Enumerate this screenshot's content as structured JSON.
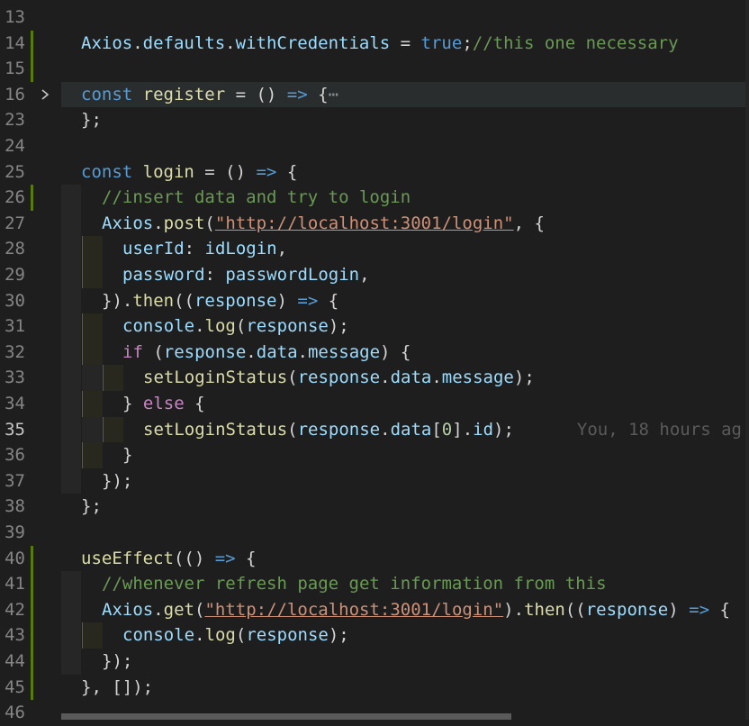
{
  "editor": {
    "theme": {
      "background": "#1e1e1e",
      "keyword": "#569cd6",
      "string": "#ce9178",
      "comment": "#6a9955",
      "function": "#dcdcaa",
      "variable": "#9cdcfe",
      "control": "#c586c0"
    },
    "blame_text": "You, 18 hours ag",
    "lines": [
      {
        "n": "13"
      },
      {
        "n": "14",
        "mark": "added",
        "tokens": [
          [
            "var",
            "Axios"
          ],
          [
            "p",
            "."
          ],
          [
            "var",
            "defaults"
          ],
          [
            "p",
            "."
          ],
          [
            "var",
            "withCredentials"
          ],
          [
            "p",
            " = "
          ],
          [
            "kw",
            "true"
          ],
          [
            "p",
            ";"
          ],
          [
            "cmt",
            "//this one necessary"
          ]
        ]
      },
      {
        "n": "15",
        "mark": "added"
      },
      {
        "n": "16",
        "fold": true,
        "tokens": [
          [
            "kw",
            "const "
          ],
          [
            "fn",
            "register"
          ],
          [
            "p",
            " = () "
          ],
          [
            "kw",
            "=>"
          ],
          [
            "p",
            " {"
          ],
          [
            "ell",
            "⋯"
          ]
        ]
      },
      {
        "n": "23",
        "tokens": [
          [
            "p",
            "};"
          ]
        ]
      },
      {
        "n": "24"
      },
      {
        "n": "25",
        "tokens": [
          [
            "kw",
            "const "
          ],
          [
            "fn",
            "login"
          ],
          [
            "p",
            " = () "
          ],
          [
            "kw",
            "=>"
          ],
          [
            "p",
            " {"
          ]
        ]
      },
      {
        "n": "26",
        "mark": "added",
        "indent": 1,
        "tokens": [
          [
            "cmt",
            "//insert data and try to login"
          ]
        ]
      },
      {
        "n": "27",
        "indent": 1,
        "tokens": [
          [
            "var",
            "Axios"
          ],
          [
            "p",
            "."
          ],
          [
            "fn",
            "post"
          ],
          [
            "p",
            "("
          ],
          [
            "url",
            "\"http://localhost:3001/login\""
          ],
          [
            "p",
            ", {"
          ]
        ]
      },
      {
        "n": "28",
        "indent": 2,
        "tokens": [
          [
            "var",
            "userId"
          ],
          [
            "p",
            ": "
          ],
          [
            "var",
            "idLogin"
          ],
          [
            "p",
            ","
          ]
        ]
      },
      {
        "n": "29",
        "indent": 2,
        "tokens": [
          [
            "var",
            "password"
          ],
          [
            "p",
            ": "
          ],
          [
            "var",
            "passwordLogin"
          ],
          [
            "p",
            ","
          ]
        ]
      },
      {
        "n": "30",
        "indent": 1,
        "tokens": [
          [
            "p",
            "})."
          ],
          [
            "fn",
            "then"
          ],
          [
            "p",
            "(("
          ],
          [
            "var",
            "response"
          ],
          [
            "p",
            ") "
          ],
          [
            "kw",
            "=>"
          ],
          [
            "p",
            " {"
          ]
        ]
      },
      {
        "n": "31",
        "indent": 2,
        "tokens": [
          [
            "var",
            "console"
          ],
          [
            "p",
            "."
          ],
          [
            "fn",
            "log"
          ],
          [
            "p",
            "("
          ],
          [
            "var",
            "response"
          ],
          [
            "p",
            ");"
          ]
        ]
      },
      {
        "n": "32",
        "indent": 2,
        "tokens": [
          [
            "ctrl",
            "if"
          ],
          [
            "p",
            " ("
          ],
          [
            "var",
            "response"
          ],
          [
            "p",
            "."
          ],
          [
            "var",
            "data"
          ],
          [
            "p",
            "."
          ],
          [
            "var",
            "message"
          ],
          [
            "p",
            ") {"
          ]
        ]
      },
      {
        "n": "33",
        "indent": 3,
        "tokens": [
          [
            "fn",
            "setLoginStatus"
          ],
          [
            "p",
            "("
          ],
          [
            "var",
            "response"
          ],
          [
            "p",
            "."
          ],
          [
            "var",
            "data"
          ],
          [
            "p",
            "."
          ],
          [
            "var",
            "message"
          ],
          [
            "p",
            ");"
          ]
        ]
      },
      {
        "n": "34",
        "indent": 2,
        "tokens": [
          [
            "p",
            "} "
          ],
          [
            "ctrl",
            "else"
          ],
          [
            "p",
            " {"
          ]
        ]
      },
      {
        "n": "35",
        "indent": 3,
        "current": true,
        "tokens": [
          [
            "fn",
            "setLoginStatus"
          ],
          [
            "p",
            "("
          ],
          [
            "var",
            "response"
          ],
          [
            "p",
            "."
          ],
          [
            "var",
            "data"
          ],
          [
            "p",
            "["
          ],
          [
            "num",
            "0"
          ],
          [
            "p",
            "]."
          ],
          [
            "var",
            "id"
          ],
          [
            "p",
            ");"
          ]
        ],
        "blame": true
      },
      {
        "n": "36",
        "indent": 2,
        "tokens": [
          [
            "p",
            "}"
          ]
        ]
      },
      {
        "n": "37",
        "indent": 1,
        "tokens": [
          [
            "p",
            "});"
          ]
        ]
      },
      {
        "n": "38",
        "tokens": [
          [
            "p",
            "};"
          ]
        ]
      },
      {
        "n": "39"
      },
      {
        "n": "40",
        "mark": "added",
        "tokens": [
          [
            "fn",
            "useEffect"
          ],
          [
            "p",
            "(() "
          ],
          [
            "kw",
            "=>"
          ],
          [
            "p",
            " {"
          ]
        ]
      },
      {
        "n": "41",
        "mark": "added",
        "indent": 1,
        "tokens": [
          [
            "cmt",
            "//whenever refresh page get information from this"
          ]
        ]
      },
      {
        "n": "42",
        "mark": "added",
        "indent": 1,
        "tokens": [
          [
            "var",
            "Axios"
          ],
          [
            "p",
            "."
          ],
          [
            "fn",
            "get"
          ],
          [
            "p",
            "("
          ],
          [
            "url",
            "\"http://localhost:3001/login\""
          ],
          [
            "p",
            ")."
          ],
          [
            "fn",
            "then"
          ],
          [
            "p",
            "(("
          ],
          [
            "var",
            "response"
          ],
          [
            "p",
            ") "
          ],
          [
            "kw",
            "=>"
          ],
          [
            "p",
            " {"
          ]
        ]
      },
      {
        "n": "43",
        "mark": "added",
        "indent": 2,
        "tokens": [
          [
            "var",
            "console"
          ],
          [
            "p",
            "."
          ],
          [
            "fn",
            "log"
          ],
          [
            "p",
            "("
          ],
          [
            "var",
            "response"
          ],
          [
            "p",
            ");"
          ]
        ]
      },
      {
        "n": "44",
        "mark": "added",
        "indent": 1,
        "tokens": [
          [
            "p",
            "});"
          ]
        ]
      },
      {
        "n": "45",
        "mark": "added",
        "tokens": [
          [
            "p",
            "}, []);"
          ]
        ]
      },
      {
        "n": "46"
      }
    ]
  }
}
